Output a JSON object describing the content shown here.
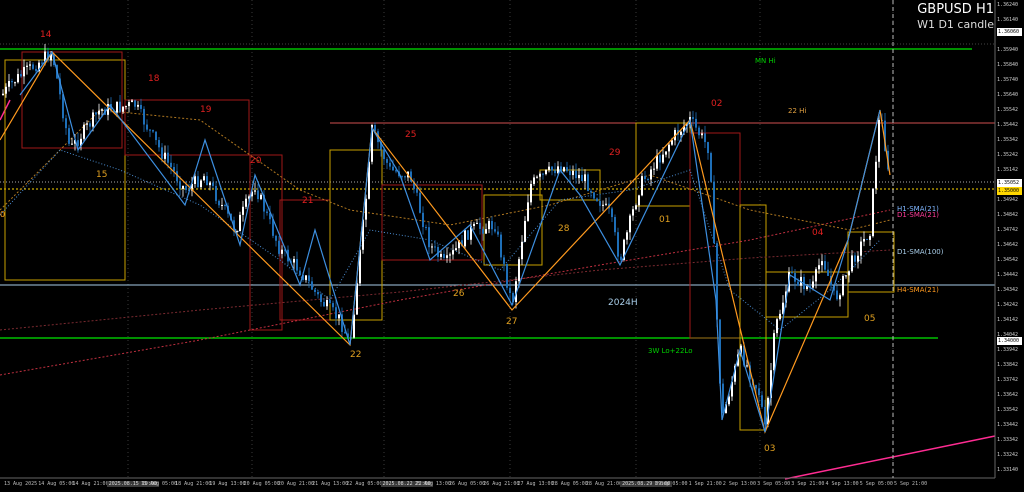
{
  "header": {
    "symbol_timeframe": "GBPUSD H1",
    "subtitle": "W1 D1 candle"
  },
  "colors": {
    "background": "#000000",
    "bull_candle": "#ffffff",
    "bear_candle": "#1e6fb8",
    "zigzag_orange": "#ff9a1f",
    "zigzag_blue": "#3d8fe0",
    "green_level": "#00c000",
    "pink_trend": "#ff2c92",
    "light_blue_level": "#a8cde8",
    "red_box": "#a01818",
    "yellow_box": "#c8a000"
  },
  "price_axis": {
    "labels": [
      "1.36240",
      "1.36140",
      "1.36040",
      "1.35940",
      "1.35840",
      "1.35740",
      "1.35640",
      "1.35542",
      "1.35442",
      "1.35342",
      "1.35242",
      "1.35142",
      "1.35042",
      "1.34942",
      "1.34842",
      "1.34742",
      "1.34642",
      "1.34542",
      "1.34442",
      "1.34342",
      "1.34242",
      "1.34142",
      "1.34042",
      "1.33942",
      "1.33842",
      "1.33742",
      "1.33642",
      "1.33542",
      "1.33442",
      "1.33342",
      "1.33242",
      "1.33140"
    ],
    "highlight_top": "1.36060",
    "highlight_mid1": "1.35052",
    "highlight_mid2": "1.35000",
    "highlight_bottom": "1.34000"
  },
  "time_axis": {
    "labels": [
      "13 Aug 2025",
      "14 Aug 05:00",
      "14 Aug 21:00",
      "2025.08.15 10:00",
      "15 Aug 05:00",
      "18 Aug 21:00",
      "19 Aug 13:00",
      "20 Aug 05:00",
      "20 Aug 21:00",
      "21 Aug 13:00",
      "22 Aug 05:00",
      "2025.08.22 22:00",
      "25 Aug 13:00",
      "26 Aug 05:00",
      "26 Aug 21:00",
      "27 Aug 13:00",
      "28 Aug 05:00",
      "28 Aug 21:00",
      "2025.08.29 09:00",
      "1 Sep 05:00",
      "1 Sep 21:00",
      "2 Sep 13:00",
      "3 Sep 05:00",
      "3 Sep 21:00",
      "4 Sep 13:00",
      "5 Sep 05:00",
      "5 Sep 21:00"
    ],
    "highlighted": [
      3,
      11,
      18
    ]
  },
  "wave_labels": {
    "red": [
      "14",
      "18",
      "19",
      "20",
      "21",
      "25",
      "29",
      "02",
      "04"
    ],
    "yellow": [
      "15",
      "22",
      "26",
      "27",
      "28",
      "01",
      "03",
      "05"
    ]
  },
  "indicator_labels": {
    "mn_high": "MN Hi",
    "d22_high": "22 Hi",
    "h1_sma": "H1-SMA(21)",
    "d1_sma_21": "D1-SMA(21)",
    "d1_sma_100": "D1-SMA(100)",
    "h4_sma": "H4-SMA(21)",
    "w3_low": "3W Lo+22Lo",
    "year_2024": "2024H"
  },
  "pane_edge_marker": "0"
}
